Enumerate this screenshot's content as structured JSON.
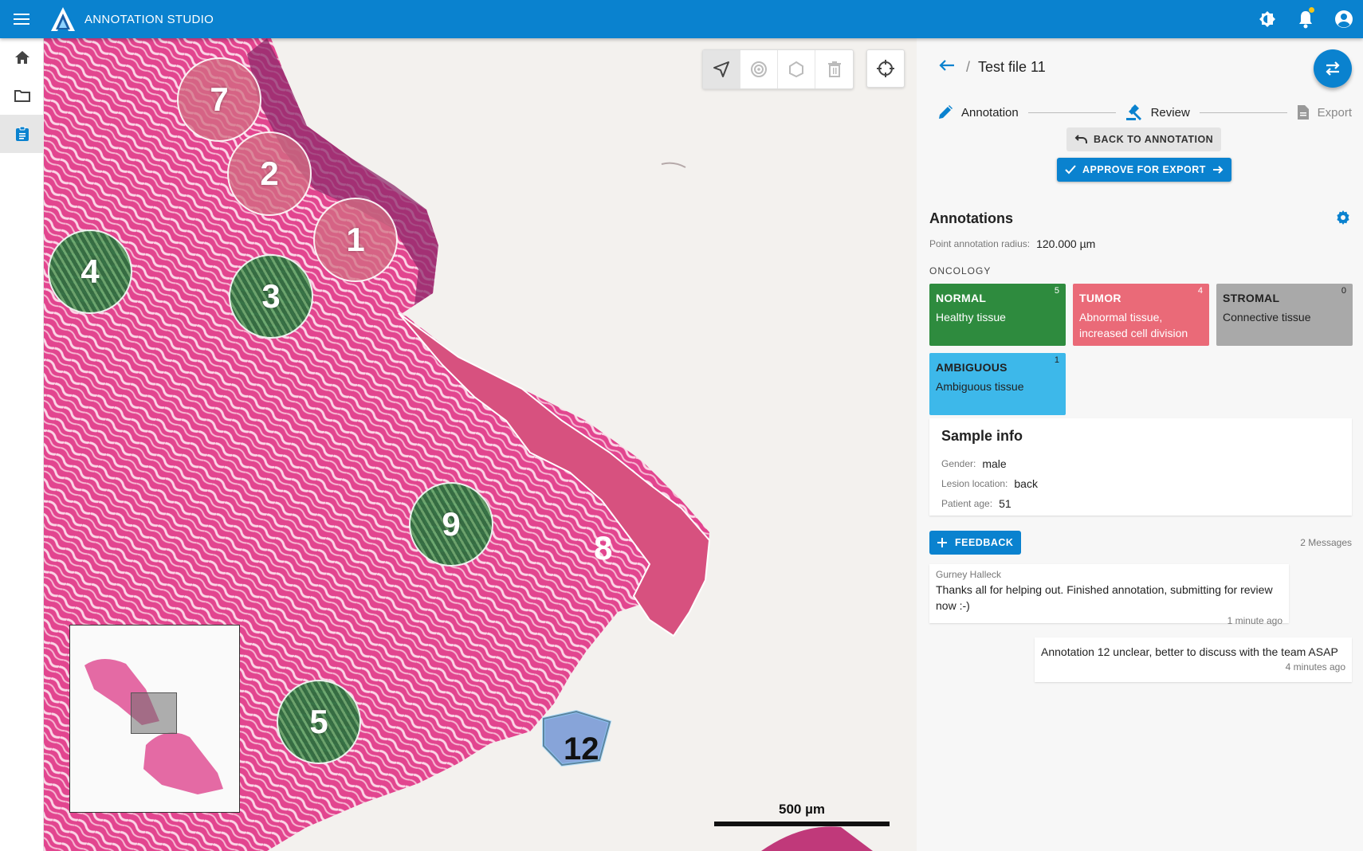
{
  "app": {
    "title": "ANNOTATION STUDIO"
  },
  "colors": {
    "primary": "#0a82cf",
    "normal": "#2e8b3e",
    "tumor": "#ea6a78",
    "stromal": "#a9a9a9",
    "ambiguous": "#3db8ea"
  },
  "topbar_icons": [
    "menu-icon",
    "brightness-icon",
    "bell-icon",
    "account-icon"
  ],
  "rail": [
    "home-icon",
    "folder-icon",
    "clipboard-icon"
  ],
  "viewer": {
    "markers": [
      {
        "id": "7",
        "cls": "tumor"
      },
      {
        "id": "2",
        "cls": "tumor"
      },
      {
        "id": "1",
        "cls": "tumor"
      },
      {
        "id": "4",
        "cls": "normal"
      },
      {
        "id": "3",
        "cls": "normal"
      },
      {
        "id": "9",
        "cls": "normal"
      },
      {
        "id": "5",
        "cls": "normal"
      }
    ],
    "region_labels": {
      "r8": "8",
      "r12": "12"
    },
    "scale": "500 µm",
    "tools": [
      "navigate-icon",
      "point-icon",
      "polygon-icon",
      "delete-icon"
    ]
  },
  "panel": {
    "breadcrumb_sep": "/",
    "file_name": "Test file 11",
    "steps": {
      "annotation": "Annotation",
      "review": "Review",
      "export": "Export"
    },
    "back_button": "BACK TO ANNOTATION",
    "approve_button": "APPROVE FOR EXPORT",
    "annotations_title": "Annotations",
    "radius_label": "Point annotation radius:",
    "radius_value": "120.000 µm",
    "section": "ONCOLOGY",
    "classes": [
      {
        "name": "NORMAL",
        "desc": "Healthy tissue",
        "count": "5"
      },
      {
        "name": "TUMOR",
        "desc": "Abnormal tissue, increased cell division",
        "count": "4"
      },
      {
        "name": "STROMAL",
        "desc": "Connective tissue",
        "count": "0"
      },
      {
        "name": "AMBIGUOUS",
        "desc": "Ambiguous tissue",
        "count": "1"
      }
    ],
    "sample": {
      "title": "Sample info",
      "gender_label": "Gender:",
      "gender": "male",
      "location_label": "Lesion location:",
      "location": "back",
      "age_label": "Patient age:",
      "age": "51"
    },
    "feedback_button": "FEEDBACK",
    "message_count": "2 Messages",
    "messages": [
      {
        "author": "Gurney Halleck",
        "text": "Thanks all for helping out. Finished annotation, submitting for review now :-)",
        "time": "1 minute ago"
      },
      {
        "text": "Annotation 12 unclear, better to discuss with the team ASAP",
        "time": "4 minutes ago"
      }
    ]
  }
}
